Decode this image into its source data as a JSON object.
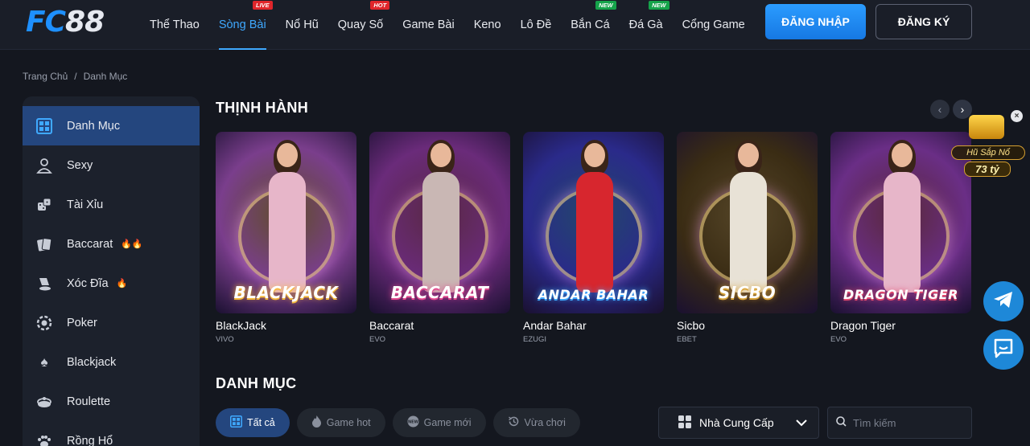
{
  "header": {
    "logo": "FC88",
    "nav": [
      {
        "label": "Thể Thao",
        "badge": ""
      },
      {
        "label": "Sòng Bài",
        "badge": "LIVE",
        "active": true
      },
      {
        "label": "Nổ Hũ",
        "badge": ""
      },
      {
        "label": "Quay Số",
        "badge": "HOT"
      },
      {
        "label": "Game Bài",
        "badge": ""
      },
      {
        "label": "Keno",
        "badge": ""
      },
      {
        "label": "Lô Đề",
        "badge": ""
      },
      {
        "label": "Bắn Cá",
        "badge": "NEW"
      },
      {
        "label": "Đá Gà",
        "badge": "NEW"
      },
      {
        "label": "Cổng Game",
        "badge": ""
      }
    ],
    "login_label": "ĐĂNG NHẬP",
    "register_label": "ĐĂNG KÝ"
  },
  "breadcrumb": [
    "Trang Chủ",
    "/",
    "Danh Mục"
  ],
  "sidebar": {
    "items": [
      {
        "label": "Danh Mục",
        "icon": "grid-icon",
        "active": true,
        "fires": 0
      },
      {
        "label": "Sexy",
        "icon": "dealer-icon",
        "fires": 0
      },
      {
        "label": "Tài Xỉu",
        "icon": "dice-icon",
        "fires": 0
      },
      {
        "label": "Baccarat",
        "icon": "cards-icon",
        "fires": 2
      },
      {
        "label": "Xóc Đĩa",
        "icon": "shaker-icon",
        "fires": 1
      },
      {
        "label": "Poker",
        "icon": "chip-icon",
        "fires": 0
      },
      {
        "label": "Blackjack",
        "icon": "spade-icon",
        "fires": 0
      },
      {
        "label": "Roulette",
        "icon": "roulette-icon",
        "fires": 0
      },
      {
        "label": "Rồng Hổ",
        "icon": "paw-icon",
        "fires": 0
      }
    ]
  },
  "trending": {
    "title": "THỊNH HÀNH",
    "games": [
      {
        "name": "BlackJack",
        "provider": "VIVO",
        "art_title": "BLACKJACK",
        "bg": "#7a3e8c",
        "accent": "#f6b93b",
        "dress": "#e7b6c9"
      },
      {
        "name": "Baccarat",
        "provider": "EVO",
        "art_title": "BACCARAT",
        "bg": "#6a2b7a",
        "accent": "#e34a8e",
        "dress": "#c9b7b4"
      },
      {
        "name": "Andar Bahar",
        "provider": "EZUGI",
        "art_title": "ANDAR BAHAR",
        "bg": "#2a2a8a",
        "accent": "#3fa9ff",
        "dress": "#d7262e"
      },
      {
        "name": "Sicbo",
        "provider": "EBET",
        "art_title": "SICBO",
        "bg": "#3a2c14",
        "accent": "#d9a43a",
        "dress": "#e8e2d6"
      },
      {
        "name": "Dragon Tiger",
        "provider": "EVO",
        "art_title": "DRAGON TIGER",
        "bg": "#6a2e86",
        "accent": "#e34a6e",
        "dress": "#e7b6c9"
      }
    ]
  },
  "categories": {
    "title": "DANH MỤC",
    "filters": [
      {
        "label": "Tất cả",
        "icon": "grid-icon",
        "active": true
      },
      {
        "label": "Game hot",
        "icon": "flame-icon"
      },
      {
        "label": "Game mới",
        "icon": "new-icon"
      },
      {
        "label": "Vừa chơi",
        "icon": "history-icon"
      }
    ],
    "provider_label": "Nhà Cung Cấp",
    "search_placeholder": "Tìm kiếm"
  },
  "jackpot": {
    "label": "Hũ Sắp Nổ",
    "amount": "73 tỷ"
  },
  "colors": {
    "accent": "#3fa9ff",
    "active_bg": "#24467e",
    "page_bg": "#14171f"
  }
}
